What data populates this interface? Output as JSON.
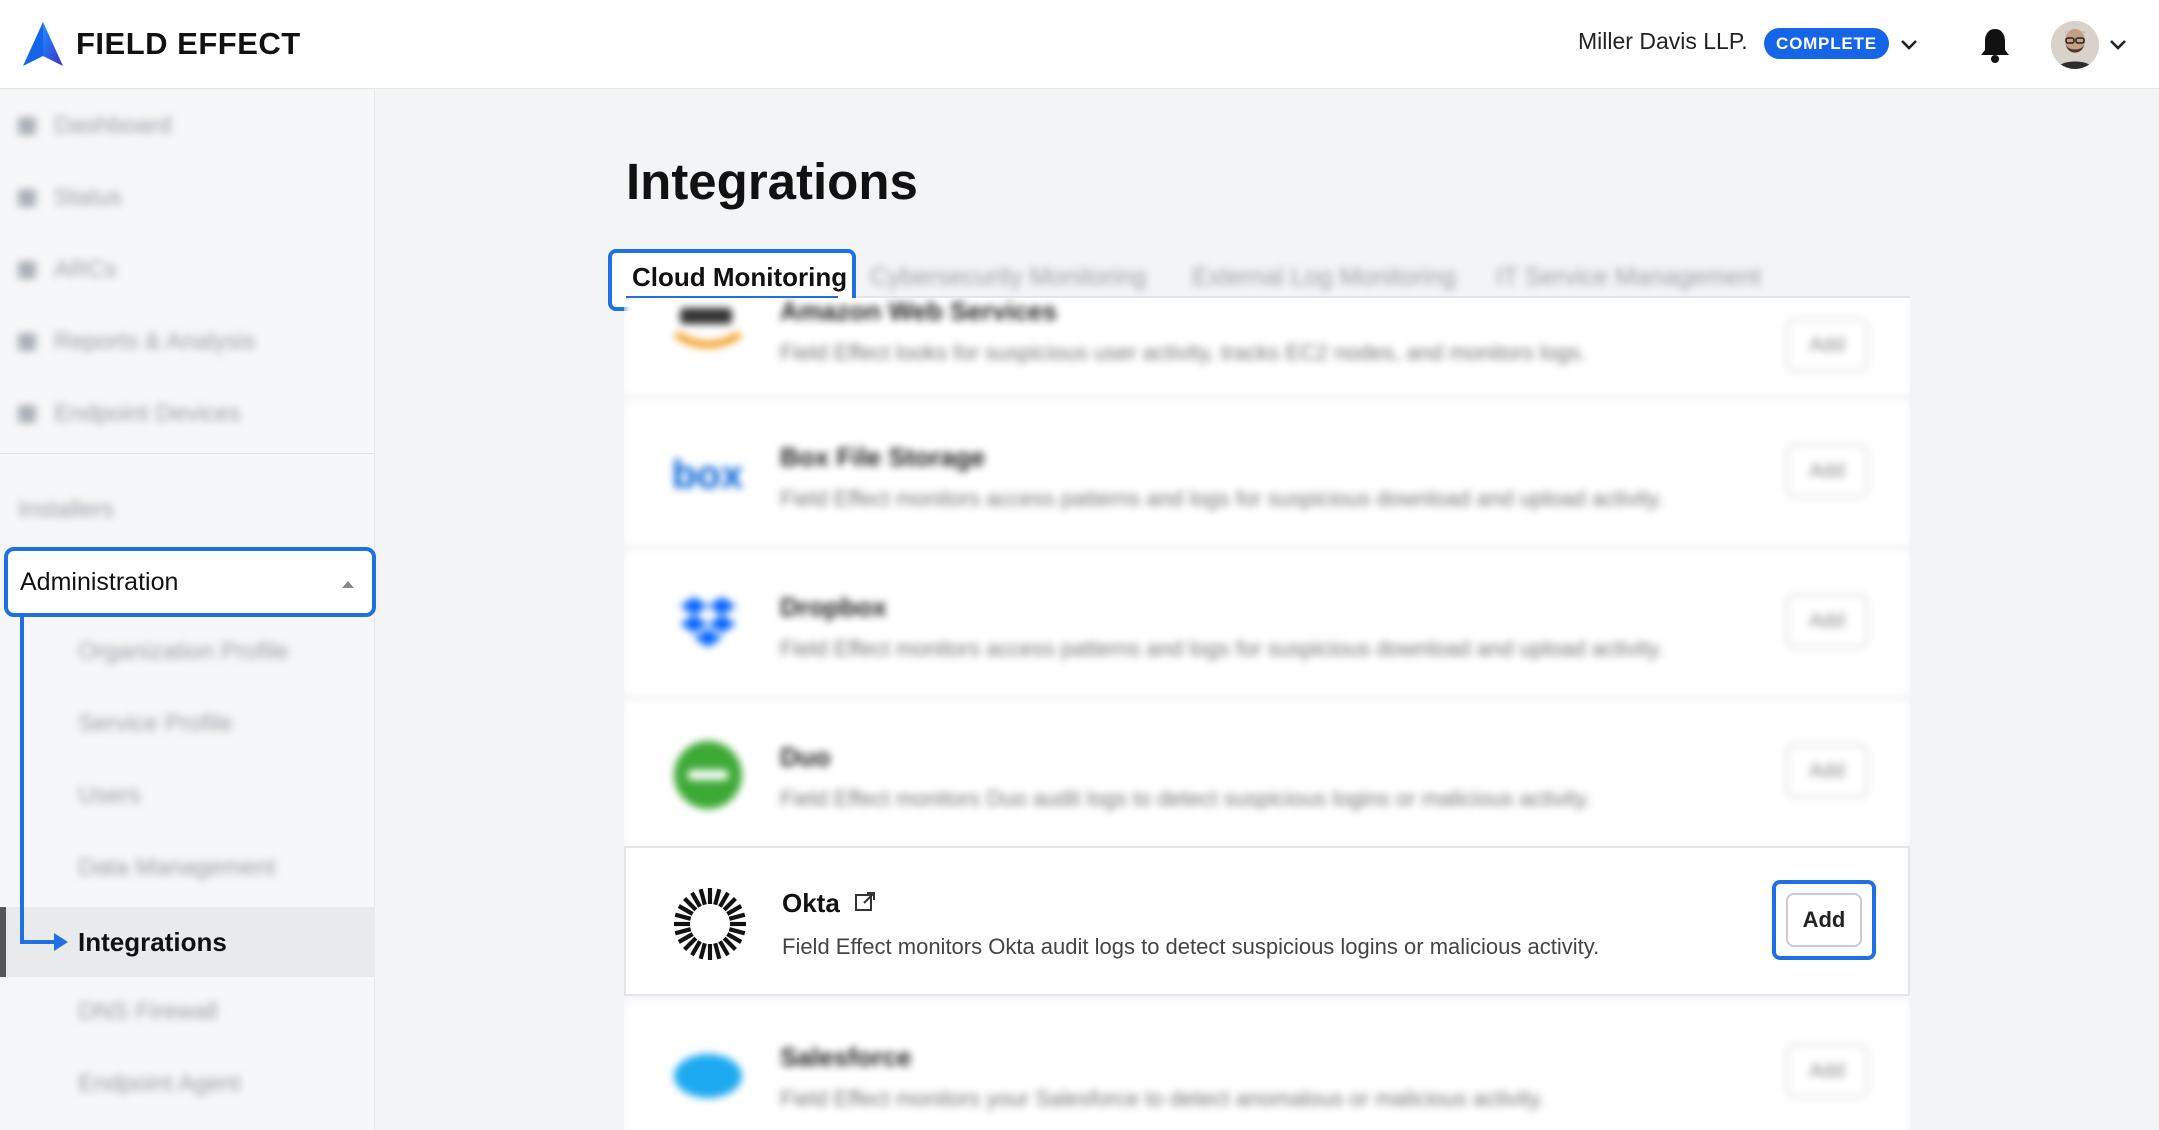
{
  "header": {
    "brand": "FIELD EFFECT",
    "org_name": "Miller Davis LLP.",
    "org_status": "COMPLETE"
  },
  "sidebar": {
    "top_items": [
      "Dashboard",
      "Status",
      "ARCs",
      "Reports & Analysis",
      "Endpoint Devices"
    ],
    "installers_label": "Installers",
    "admin_label": "Administration",
    "admin_sub_items": [
      "Organization Profile",
      "Service Profile",
      "Users",
      "Data Management"
    ],
    "active_item": "Integrations",
    "lower_items": [
      "DNS Firewall",
      "Endpoint Agent"
    ]
  },
  "main": {
    "title": "Integrations",
    "tabs": [
      "Cloud Monitoring",
      "Cybersecurity Monitoring",
      "External Log Monitoring",
      "IT Service Management"
    ],
    "integrations": [
      {
        "name": "Amazon Web Services",
        "desc": "Field Effect looks for suspicious user activity, tracks EC2 nodes, and monitors logs.",
        "button": "Add"
      },
      {
        "name": "Box File Storage",
        "desc": "Field Effect monitors access patterns and logs for suspicious download and upload activity.",
        "button": "Add"
      },
      {
        "name": "Dropbox",
        "desc": "Field Effect monitors access patterns and logs for suspicious download and upload activity.",
        "button": "Add"
      },
      {
        "name": "Duo",
        "desc": "Field Effect monitors Duo audit logs to detect suspicious logins or malicious activity.",
        "button": "Add"
      }
    ],
    "okta": {
      "name": "Okta",
      "desc": "Field Effect monitors Okta audit logs to detect suspicious logins or malicious activity.",
      "button": "Add"
    },
    "salesforce": {
      "name": "Salesforce",
      "desc": "Field Effect monitors your Salesforce to detect anomalous or malicious activity.",
      "button": "Add"
    }
  },
  "colors": {
    "accent": "#1f6fe5",
    "badge": "#1565e8"
  }
}
